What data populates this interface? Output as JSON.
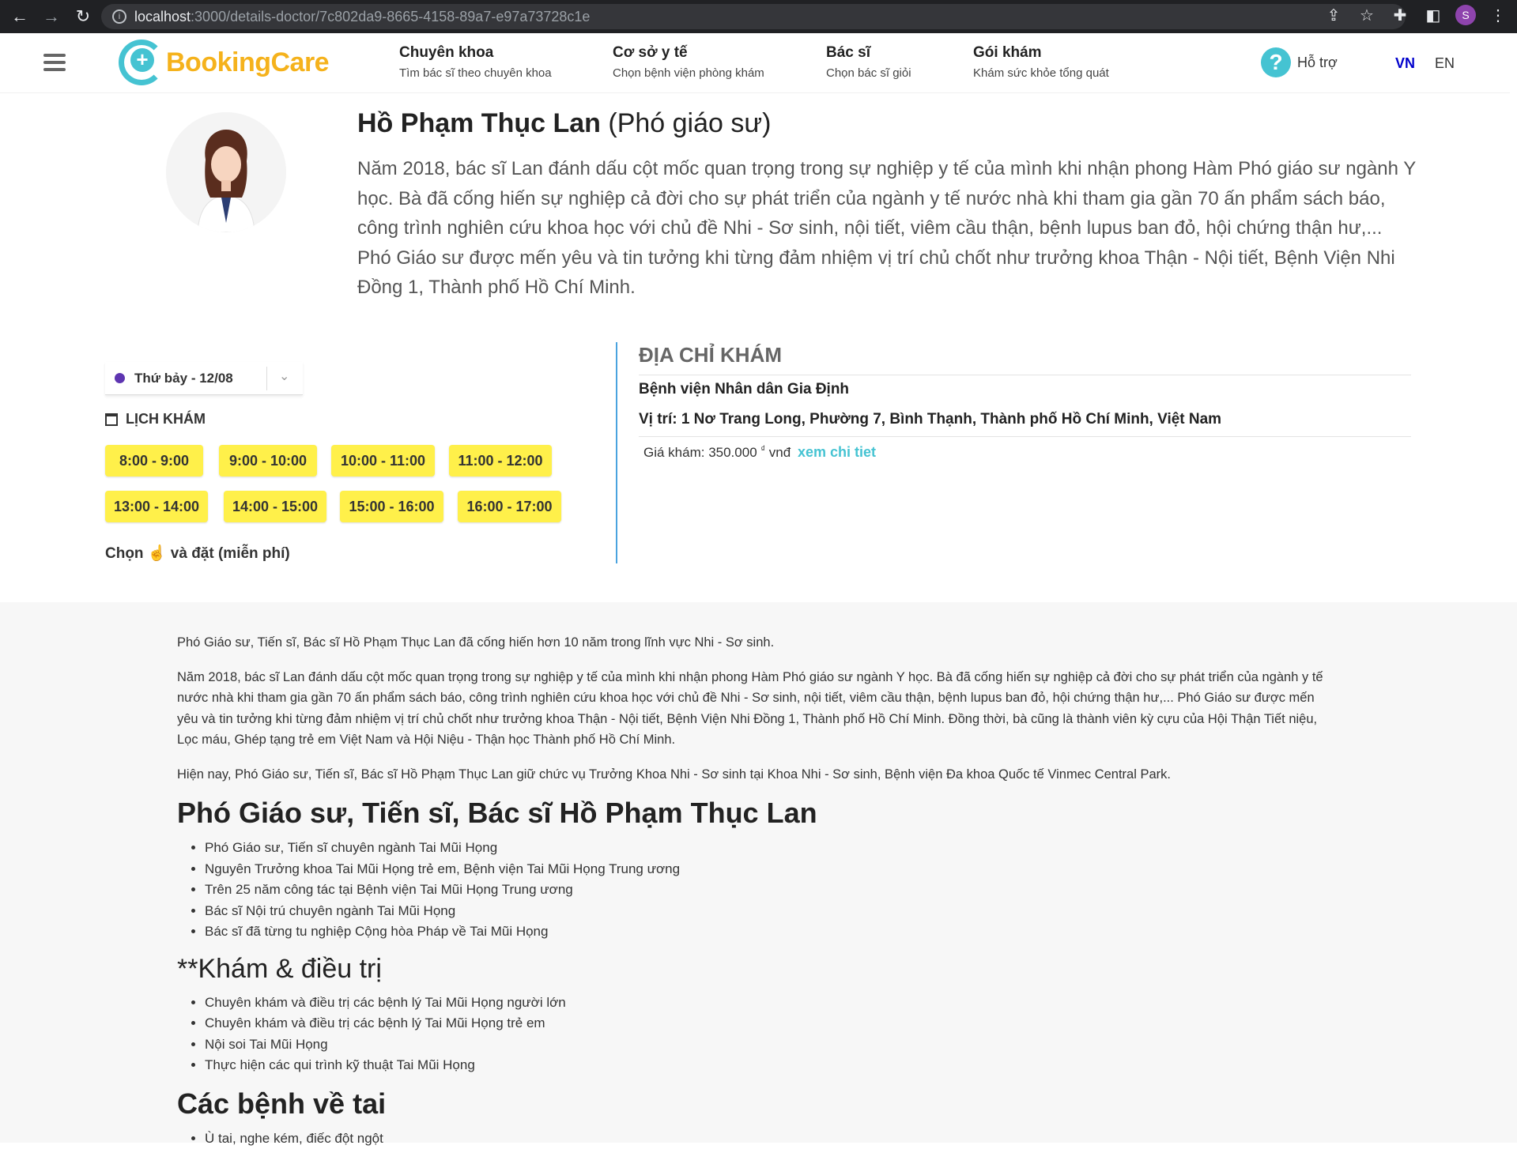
{
  "browser": {
    "url_host": "localhost",
    "url_path": ":3000/details-doctor/7c802da9-8665-4158-89a7-e97a73728c1e",
    "profile_initial": "S"
  },
  "header": {
    "logo_text": "BookingCare",
    "nav": [
      {
        "title": "Chuyên khoa",
        "subtitle": "Tìm bác sĩ theo chuyên khoa"
      },
      {
        "title": "Cơ sở y tế",
        "subtitle": "Chọn bệnh viện phòng khám"
      },
      {
        "title": "Bác sĩ",
        "subtitle": "Chọn bác sĩ giỏi"
      },
      {
        "title": "Gói khám",
        "subtitle": "Khám sức khỏe tổng quát"
      }
    ],
    "support_label": "Hỗ trợ",
    "lang_vn": "VN",
    "lang_en": "EN"
  },
  "doctor": {
    "name": "Hồ Phạm Thục Lan",
    "position": "(Phó giáo sư)",
    "description": "Năm 2018, bác sĩ Lan đánh dấu cột mốc quan trọng trong sự nghiệp y tế của mình khi nhận phong Hàm Phó giáo sư ngành Y học. Bà đã cống hiến sự nghiệp cả đời cho sự phát triển của ngành y tế nước nhà khi tham gia gần 70 ấn phẩm sách báo, công trình nghiên cứu khoa học với chủ đề Nhi - Sơ sinh, nội tiết, viêm cầu thận, bệnh lupus ban đỏ, hội chứng thận hư,... Phó Giáo sư được mến yêu và tin tưởng khi từng đảm nhiệm vị trí chủ chốt như trưởng khoa Thận - Nội tiết, Bệnh Viện Nhi Đồng 1, Thành phố Hồ Chí Minh."
  },
  "schedule": {
    "selected_date": "Thứ bảy - 12/08",
    "title": "LỊCH KHÁM",
    "slots_row1": [
      "8:00 - 9:00",
      "9:00 - 10:00",
      "10:00 - 11:00",
      "11:00 - 12:00"
    ],
    "slots_row2": [
      "13:00 - 14:00",
      "14:00 - 15:00",
      "15:00 - 16:00",
      "16:00 - 17:00"
    ],
    "book_hint_pre": "Chọn",
    "book_hint_post": "và đặt (miễn phí)"
  },
  "address": {
    "title": "ĐỊA CHỈ KHÁM",
    "clinic_name": "Bệnh viện Nhân dân Gia Định",
    "clinic_address": "Vị trí: 1 Nơ Trang Long, Phường 7, Bình Thạnh, Thành phố Hồ Chí Minh, Việt Nam",
    "price_label": "Giá khám: 350.000",
    "price_currency": "₫",
    "price_unit": "vnđ",
    "price_link": "xem chi tiet"
  },
  "detail": {
    "p1": "Phó Giáo sư, Tiến sĩ, Bác sĩ Hồ Phạm Thục Lan đã cống hiến hơn 10 năm trong lĩnh vực Nhi - Sơ sinh.",
    "p2": "Năm 2018, bác sĩ Lan đánh dấu cột mốc quan trọng trong sự nghiệp y tế của mình khi nhận phong Hàm Phó giáo sư ngành Y học. Bà đã cống hiến sự nghiệp cả đời cho sự phát triển của ngành y tế nước nhà khi tham gia gần 70 ấn phẩm sách báo, công trình nghiên cứu khoa học với chủ đề Nhi - Sơ sinh, nội tiết, viêm cầu thận, bệnh lupus ban đỏ, hội chứng thận hư,... Phó Giáo sư được mến yêu và tin tưởng khi từng đảm nhiệm vị trí chủ chốt như trưởng khoa Thận - Nội tiết, Bệnh Viện Nhi Đồng 1, Thành phố Hồ Chí Minh. Đồng thời, bà cũng là thành viên kỳ cựu của Hội Thận Tiết niệu, Lọc máu, Ghép tạng trẻ em Việt Nam và Hội Niệu - Thận học Thành phố Hồ Chí Minh.",
    "p3": "Hiện nay, Phó Giáo sư, Tiến sĩ, Bác sĩ Hồ Phạm Thục Lan giữ chức vụ Trưởng Khoa Nhi - Sơ sinh tại Khoa Nhi - Sơ sinh, Bệnh viện Đa khoa Quốc tế Vinmec Central Park.",
    "h1": "Phó Giáo sư, Tiến sĩ, Bác sĩ Hồ Phạm Thục Lan",
    "list1": [
      "Phó Giáo sư, Tiến sĩ chuyên ngành Tai Mũi Họng",
      "Nguyên Trưởng khoa Tai Mũi Họng trẻ em, Bệnh viện Tai Mũi Họng Trung ương",
      "Trên 25 năm công tác tại Bệnh viện Tai Mũi Họng Trung ương",
      "Bác sĩ Nội trú chuyên ngành Tai Mũi Họng",
      "Bác sĩ đã từng tu nghiệp Cộng hòa Pháp về Tai Mũi Họng"
    ],
    "h2": "**Khám & điều trị",
    "list2": [
      "Chuyên khám và điều trị các bệnh lý Tai Mũi Họng người lớn",
      "Chuyên khám và điều trị các bệnh lý Tai Mũi Họng trẻ em",
      "Nội soi Tai Mũi Họng",
      "Thực hiện các qui trình kỹ thuật Tai Mũi Họng"
    ],
    "h3": "Các bệnh về tai",
    "list3": [
      "Ù tai, nghe kém, điếc đột ngột"
    ]
  }
}
